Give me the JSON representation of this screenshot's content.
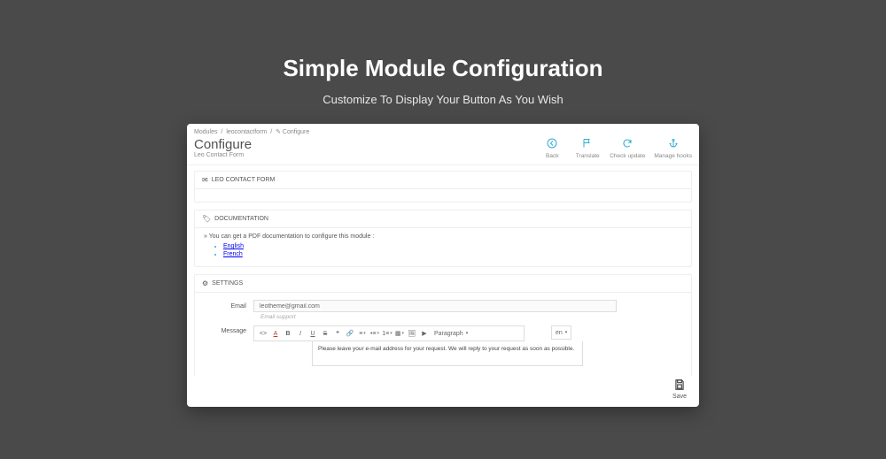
{
  "hero": {
    "title": "Simple Module Configuration",
    "subtitle": "Customize To Display Your Button As You Wish"
  },
  "breadcrumb": {
    "item1": "Modules",
    "item2": "leocontactform",
    "item3": "Configure"
  },
  "page": {
    "title": "Configure",
    "subtitle": "Leo Contact Form"
  },
  "actions": {
    "back": "Back",
    "translate": "Translate",
    "check_update": "Check update",
    "manage_hooks": "Manage hooks"
  },
  "panels": {
    "leo_form_title": "LEO CONTACT FORM",
    "documentation_title": "DOCUMENTATION",
    "doc_intro": "You can get a PDF documentation to configure this module :",
    "doc_lang_en": "English",
    "doc_lang_fr": "French",
    "settings_title": "SETTINGS"
  },
  "form": {
    "email_label": "Email",
    "email_value": "leotheme@gmail.com",
    "email_help": "Email support",
    "message_label": "Message",
    "message_value": "Please leave your e-mail address for your request. We will reply to your request as soon as possible."
  },
  "toolbar": {
    "paragraph": "Paragraph",
    "lang": "en"
  },
  "save": {
    "label": "Save"
  }
}
